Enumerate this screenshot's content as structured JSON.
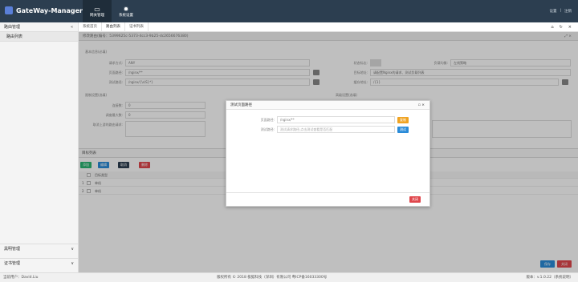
{
  "app": {
    "title": "GateWay-Manager"
  },
  "topnav": [
    {
      "label": "网关管理",
      "icon": "▭"
    },
    {
      "label": "系统设置",
      "icon": "✹"
    }
  ],
  "topright": {
    "settings": "设置",
    "logout": "注销"
  },
  "sidebar": {
    "group": "路由管理",
    "items": [
      {
        "label": "路由列表"
      }
    ],
    "bottom_groups": [
      {
        "label": "黑明管理"
      },
      {
        "label": "证书管理"
      }
    ]
  },
  "tabs": [
    {
      "label": "系统首页"
    },
    {
      "label": "路由列表"
    },
    {
      "label": "证书列表"
    }
  ],
  "panel": {
    "title": "修改路由(编号：5399625c-5373-4cc3-9b25-dc2656676380)",
    "basic_section": "基本信息(必填)",
    "fields": {
      "method_label": "请求方式:",
      "method_value": "ANY",
      "url_label": "页面路径:",
      "url_value": "/nginx/**",
      "test_label": "测试路径:",
      "test_value": "/nginx/{\\s\\S}*}",
      "status_label": "状态标志:",
      "weight_label": "负载均衡:",
      "weight_value": "左线策略",
      "target_label": "目标地址:",
      "target_value": "请配置Nginx的请求、测试负载列表",
      "cache_label": "缓存地址:",
      "cache_value": "/{1}"
    },
    "limit_section": "限制设置(选填)",
    "limit_fields": {
      "retry_label": "连接数:",
      "retry_value": "0",
      "timeout_label": "调度最大数:",
      "timeout_value": "0",
      "block_label": "取消上游的路由请求:"
    },
    "advanced_section": "高级设置(选填)"
  },
  "table": {
    "title": "目标列表",
    "buttons": {
      "add": "添加",
      "edit": "编辑",
      "cancel": "取消",
      "delete": "删除"
    },
    "header": "目标类型",
    "rows": [
      {
        "num": "1",
        "type": "单机"
      },
      {
        "num": "2",
        "type": "单机"
      }
    ]
  },
  "bottom_buttons": {
    "save": "保存",
    "close": "关闭"
  },
  "footer": {
    "user": "当前用户：David.Liu",
    "copyright": "版权所有 © 2018 极狐科技（深圳）有限公司 粤ICP备16033300号",
    "version": "版本：v.1.0.22（系统说明）"
  },
  "modal": {
    "title": "测试页面路径",
    "url_label": "页面路径:",
    "url_value": "/nginx/**",
    "url_btn": "复制",
    "test_label": "测试路径:",
    "test_placeholder": "测试请求路径,点击测试查看是否匹配",
    "test_btn": "测试",
    "close_btn": "关闭"
  },
  "colors": {
    "topbar": "#2c3e50",
    "primary": "#2a8bd8",
    "success": "#2bb673",
    "danger": "#e0474c",
    "warning": "#f0a321"
  }
}
